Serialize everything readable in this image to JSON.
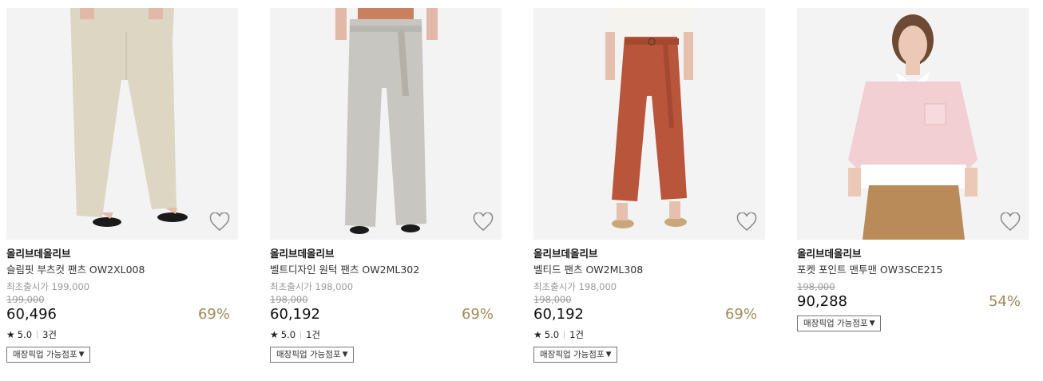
{
  "colors": {
    "discount": "#a08c5a",
    "muted": "#9a9a9a"
  },
  "products": [
    {
      "brand": "올리브데올리브",
      "name": "슬림핏 부츠컷 팬츠 OW2XL008",
      "original_label": "최초출시가 199,000",
      "list_price": "199,000",
      "price": "60,496",
      "discount": "69%",
      "rating": "5.0",
      "reviews": "3건",
      "pickup_label": "매장픽업 가능점포",
      "image_subject": "beige bootcut pants"
    },
    {
      "brand": "올리브데올리브",
      "name": "벨트디자인 원턱 팬츠 OW2ML302",
      "original_label": "최초출시가 198,000",
      "list_price": "198,000",
      "price": "60,192",
      "discount": "69%",
      "rating": "5.0",
      "reviews": "1건",
      "pickup_label": "매장픽업 가능점포",
      "image_subject": "grey wide belted pants"
    },
    {
      "brand": "올리브데올리브",
      "name": "벨티드 팬츠 OW2ML308",
      "original_label": "최초출시가 198,000",
      "list_price": "198,000",
      "price": "60,192",
      "discount": "69%",
      "rating": "5.0",
      "reviews": "1건",
      "pickup_label": "매장픽업 가능점포",
      "image_subject": "rust belted pants"
    },
    {
      "brand": "올리브데올리브",
      "name": "포켓 포인트 맨투맨 OW3SCE215",
      "list_price": "198,000",
      "price": "90,288",
      "discount": "54%",
      "pickup_label": "매장픽업 가능점포",
      "image_subject": "pink sweatshirt with white shirt"
    }
  ]
}
